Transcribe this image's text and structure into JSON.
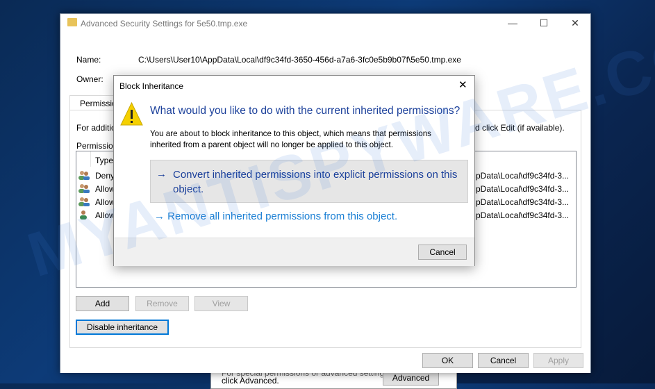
{
  "watermark": "MYANTISPYWARE.COM",
  "behind": {
    "text_line1": "For special permissions or advanced settings,",
    "text_line2": "click Advanced.",
    "advanced_button": "Advanced"
  },
  "window": {
    "title": "Advanced Security Settings for 5e50.tmp.exe",
    "name_label": "Name:",
    "name_value": "C:\\Users\\User10\\AppData\\Local\\df9c34fd-3650-456d-a7a6-3fc0e5b9b07f\\5e50.tmp.exe",
    "owner_label": "Owner:",
    "tab_label": "Permissions",
    "info_text_left": "For additio",
    "info_text_right": "d click Edit (if available).",
    "entries_label": "Permission",
    "column_type": "Type",
    "rows": [
      {
        "type": "Deny",
        "inherited": "pData\\Local\\df9c34fd-3...",
        "icon": "group-icon"
      },
      {
        "type": "Allow",
        "inherited": "pData\\Local\\df9c34fd-3...",
        "icon": "group-icon"
      },
      {
        "type": "Allow",
        "inherited": "pData\\Local\\df9c34fd-3...",
        "icon": "group-icon"
      },
      {
        "type": "Allow",
        "inherited": "pData\\Local\\df9c34fd-3...",
        "icon": "user-icon"
      }
    ],
    "add": "Add",
    "remove": "Remove",
    "view": "View",
    "disable_inheritance": "Disable inheritance",
    "ok": "OK",
    "cancel": "Cancel",
    "apply": "Apply"
  },
  "dialog": {
    "title": "Block Inheritance",
    "heading": "What would you like to do with the current inherited permissions?",
    "body": "You are about to block inheritance to this object, which means that permissions inherited from a parent object will no longer be applied to this object.",
    "option1": "Convert inherited permissions into explicit permissions on this object.",
    "option2": "Remove all inherited permissions from this object.",
    "cancel": "Cancel"
  },
  "colors": {
    "accent": "#0078d7",
    "link": "#1a7fd4",
    "heading": "#1a3f9a",
    "warning": "#f5d000"
  }
}
